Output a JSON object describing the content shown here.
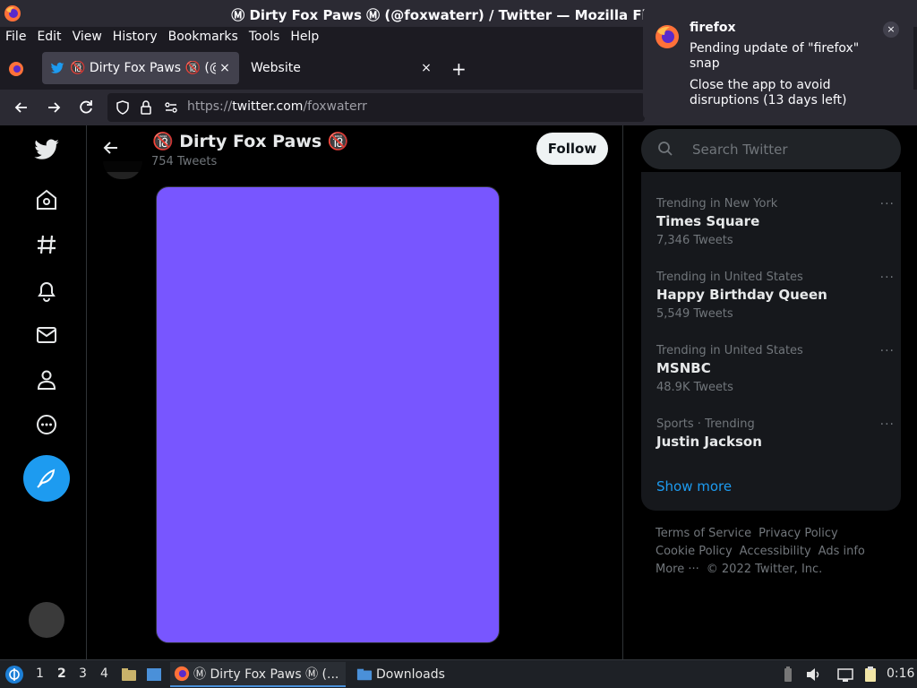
{
  "window": {
    "title": "Ⓜ Dirty Fox Paws Ⓜ (@foxwaterr) / Twitter — Mozilla Firefox"
  },
  "menu": [
    "File",
    "Edit",
    "View",
    "History",
    "Bookmarks",
    "Tools",
    "Help"
  ],
  "tabs": [
    {
      "label": "🔞 Dirty Fox Paws 🔞 (@foxwaterr)",
      "active": true
    },
    {
      "label": "Website",
      "active": false
    }
  ],
  "tab_close": "×",
  "new_tab": "+",
  "url": {
    "prefix": "https://",
    "host": "twitter.com",
    "path": "/foxwaterr"
  },
  "profile": {
    "name": "🔞 Dirty Fox Paws 🔞",
    "tweets": "754 Tweets",
    "follow_label": "Follow"
  },
  "search": {
    "placeholder": "Search Twitter"
  },
  "trends": [
    {
      "context": "Trending in New York",
      "name": "Times Square",
      "count": "7,346 Tweets"
    },
    {
      "context": "Trending in United States",
      "name": "Happy Birthday Queen",
      "count": "5,549 Tweets"
    },
    {
      "context": "Trending in United States",
      "name": "MSNBC",
      "count": "48.9K Tweets"
    },
    {
      "context": "Sports · Trending",
      "name": "Justin Jackson",
      "count": ""
    }
  ],
  "trend_more": "···",
  "show_more": "Show more",
  "footer": {
    "terms": "Terms of Service",
    "privacy": "Privacy Policy",
    "cookie": "Cookie Policy",
    "accessibility": "Accessibility",
    "ads": "Ads info",
    "more": "More ···",
    "copyright": "© 2022 Twitter, Inc."
  },
  "notification": {
    "app": "firefox",
    "line1": "Pending update of \"firefox\" snap",
    "line2": "Close the app to avoid disruptions (13 days left)",
    "close": "×"
  },
  "taskbar": {
    "workspaces": [
      "1",
      "2",
      "3",
      "4"
    ],
    "current_workspace": "2",
    "tasks": [
      {
        "label": "Ⓜ Dirty Fox Paws Ⓜ (...",
        "active": true
      },
      {
        "label": "Downloads",
        "active": false
      }
    ],
    "clock": "0:16"
  },
  "colors": {
    "twitter_blue": "#1d9bf0",
    "media_purple": "#7856ff",
    "firefox_chrome": "#2b2a33"
  }
}
